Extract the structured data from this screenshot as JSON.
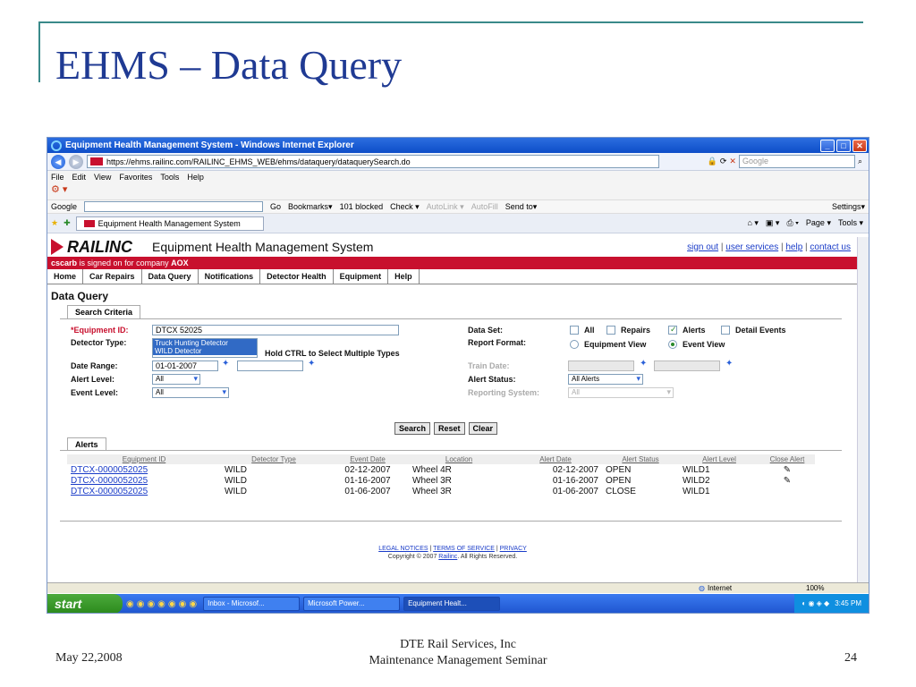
{
  "slide": {
    "title": "EHMS – Data Query",
    "footer_date": "May 22,2008",
    "footer_line1": "DTE Rail Services, Inc",
    "footer_line2": "Maintenance Management Seminar",
    "page_number": "24"
  },
  "window": {
    "title": "Equipment Health Management System - Windows Internet Explorer",
    "url": "https://ehms.railinc.com/RAILINC_EHMS_WEB/ehms/dataquery/dataquerySearch.do",
    "search_placeholder": "Google",
    "menu": [
      "File",
      "Edit",
      "View",
      "Favorites",
      "Tools",
      "Help"
    ],
    "google_bar": {
      "label": "Google",
      "go": "Go",
      "bookmarks": "Bookmarks▾",
      "blocked": "101 blocked",
      "check": "Check ▾",
      "autolink": "AutoLink ▾",
      "autofill": "AutoFill",
      "sendto": "Send to▾",
      "settings": "Settings▾"
    },
    "tab_label": "Equipment Health Management System",
    "tab_right": {
      "page": "Page ▾",
      "tools": "Tools ▾"
    }
  },
  "app": {
    "logo": "RAILINC",
    "title": "Equipment Health Management System",
    "links": {
      "sign_out": "sign out",
      "user_services": "user services",
      "help": "help",
      "contact": "contact us"
    },
    "signed_on_user": "cscarb",
    "signed_on_text": " is signed on for company ",
    "company": "AOX",
    "nav": [
      "Home",
      "Car Repairs",
      "Data Query",
      "Notifications",
      "Detector Health",
      "Equipment",
      "Help"
    ],
    "page_title": "Data Query",
    "criteria_tab": "Search Criteria"
  },
  "form": {
    "equipment_id_label": "*Equipment ID:",
    "equipment_id_value": "DTCX 52025",
    "detector_type_label": "Detector Type:",
    "detector_options": [
      "Truck Hunting Detector",
      "WILD Detector"
    ],
    "detector_hint": "Hold CTRL to Select Multiple Types",
    "date_range_label": "Date Range:",
    "date_from": "01-01-2007",
    "alert_level_label": "Alert Level:",
    "alert_level_value": "All",
    "event_level_label": "Event Level:",
    "event_level_value": "All",
    "data_set_label": "Data Set:",
    "data_set": {
      "all": "All",
      "repairs": "Repairs",
      "alerts": "Alerts",
      "detail_events": "Detail Events"
    },
    "report_format_label": "Report Format:",
    "report_format": {
      "equipment": "Equipment View",
      "event": "Event View"
    },
    "train_date_label": "Train Date:",
    "alert_status_label": "Alert Status:",
    "alert_status_value": "All Alerts",
    "reporting_system_label": "Reporting System:",
    "reporting_system_value": "All",
    "buttons": {
      "search": "Search",
      "reset": "Reset",
      "clear": "Clear"
    }
  },
  "alerts": {
    "tab": "Alerts",
    "headers": [
      "Equipment ID",
      "Detector Type",
      "Event Date",
      "Location",
      "Alert Date",
      "Alert Status",
      "Alert Level",
      "Close Alert"
    ],
    "rows": [
      {
        "id": "DTCX-0000052025",
        "type": "WILD",
        "event_date": "02-12-2007",
        "location": "Wheel 4R",
        "alert_date": "02-12-2007",
        "status": "OPEN",
        "level": "WILD1",
        "close": "✎"
      },
      {
        "id": "DTCX-0000052025",
        "type": "WILD",
        "event_date": "01-16-2007",
        "location": "Wheel 3R",
        "alert_date": "01-16-2007",
        "status": "OPEN",
        "level": "WILD2",
        "close": "✎"
      },
      {
        "id": "DTCX-0000052025",
        "type": "WILD",
        "event_date": "01-06-2007",
        "location": "Wheel 3R",
        "alert_date": "01-06-2007",
        "status": "CLOSE",
        "level": "WILD1",
        "close": ""
      }
    ]
  },
  "legal": {
    "notices": "LEGAL NOTICES",
    "terms": "TERMS OF SERVICE",
    "privacy": "PRIVACY",
    "copyright": "Copyright © 2007",
    "railinc": "Railinc",
    "rights": ". All Rights Reserved."
  },
  "status": {
    "zone": "Internet",
    "zoom": "100%"
  },
  "taskbar": {
    "start": "start",
    "tasks": [
      "Inbox - Microsof...",
      "Microsoft Power...",
      "Equipment Healt..."
    ],
    "time": "3:45 PM"
  }
}
